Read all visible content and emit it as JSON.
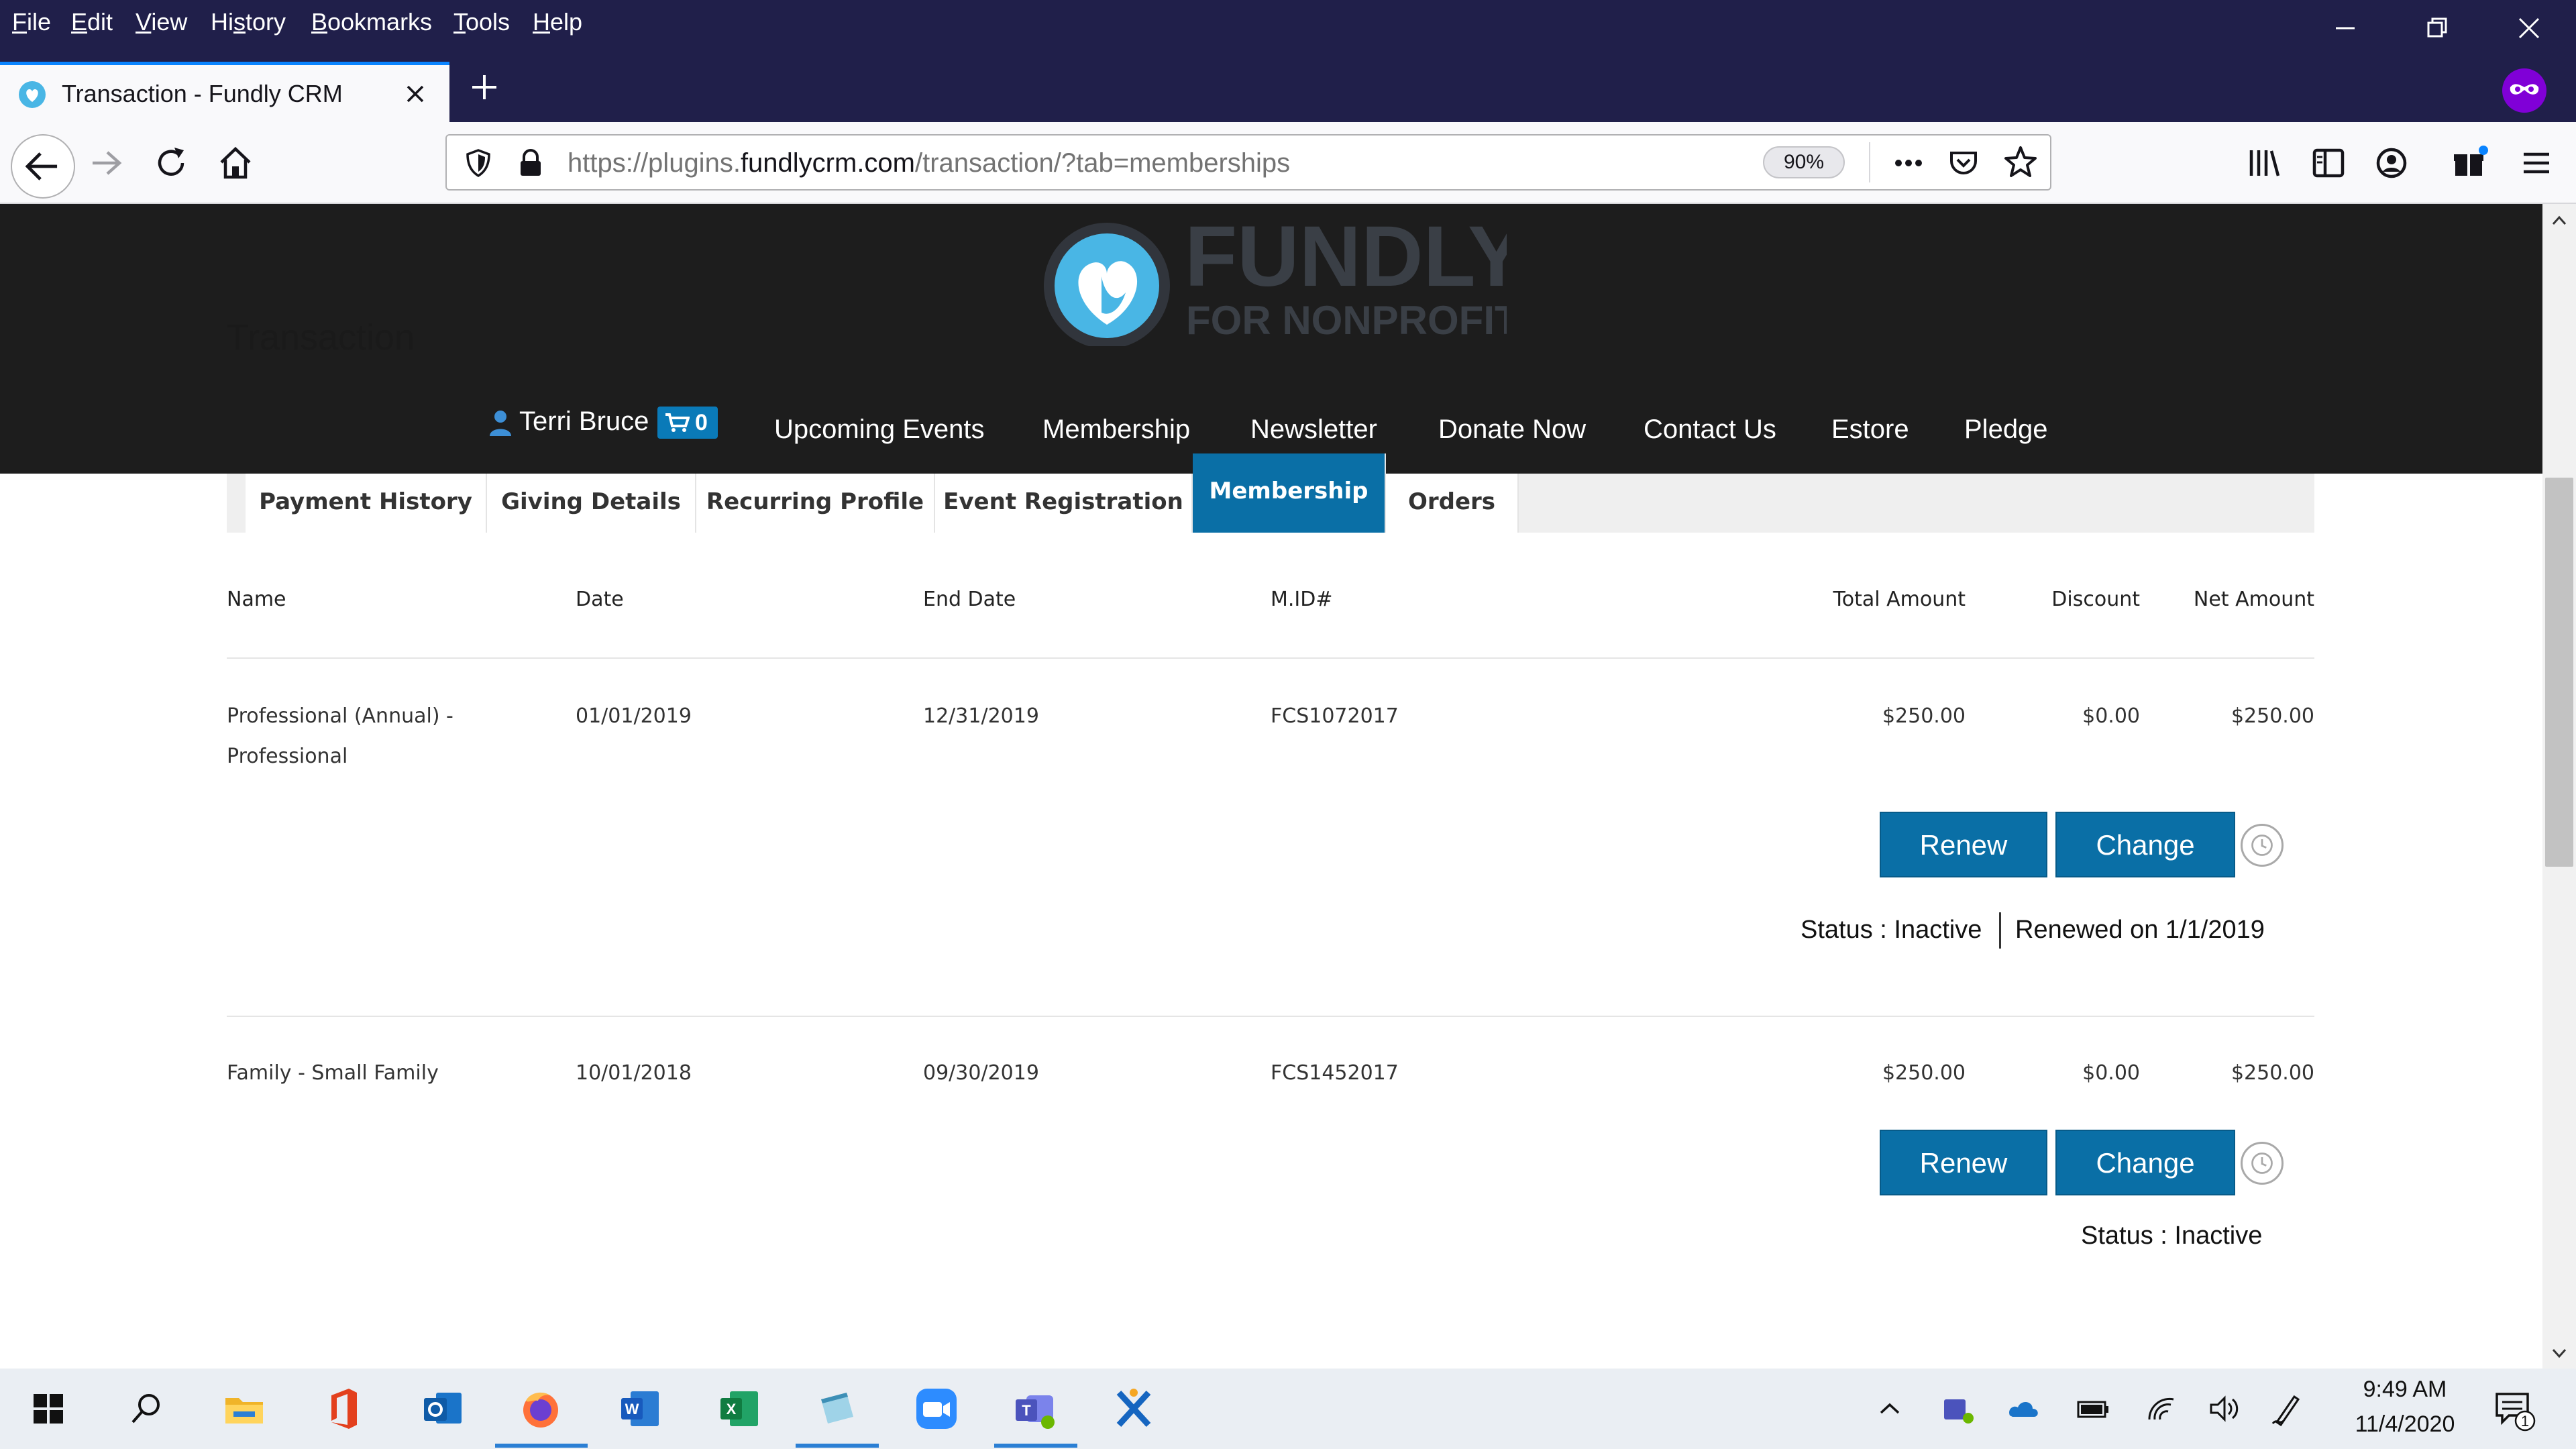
{
  "menubar": {
    "items": [
      {
        "accel": "F",
        "rest": "ile"
      },
      {
        "accel": "E",
        "rest": "dit"
      },
      {
        "accel": "V",
        "rest": "iew"
      },
      {
        "accel": "",
        "rest": "Hi",
        "accel2": "s",
        "rest2": "tory"
      },
      {
        "accel": "B",
        "rest": "ookmarks"
      },
      {
        "accel": "T",
        "rest": "ools"
      },
      {
        "accel": "H",
        "rest": "elp"
      }
    ]
  },
  "tab": {
    "title": "Transaction - Fundly CRM"
  },
  "urlbar": {
    "prefix": "https://plugins.",
    "domain": "fundlycrm.com",
    "suffix": "/transaction/?tab=memberships",
    "zoom": "90%"
  },
  "site": {
    "logo_word": "FUNDLY",
    "logo_tagline": "FOR NONPROFITS",
    "page_title": "Transaction",
    "user_name": "Terri Bruce",
    "cart_count": "0",
    "nav": [
      "Upcoming Events",
      "Membership",
      "Newsletter",
      "Donate Now",
      "Contact Us",
      "Estore",
      "Pledge"
    ]
  },
  "tabs": [
    "Payment History",
    "Giving Details",
    "Recurring Profile",
    "Event Registration",
    "Membership",
    "Orders"
  ],
  "active_tab": "Membership",
  "table": {
    "headers": {
      "name": "Name",
      "date": "Date",
      "end_date": "End Date",
      "mid": "M.ID#",
      "total": "Total Amount",
      "discount": "Discount",
      "net": "Net Amount"
    },
    "rows": [
      {
        "name_line1": "Professional (Annual) -",
        "name_line2": "Professional",
        "date": "01/01/2019",
        "end_date": "12/31/2019",
        "mid": "FCS1072017",
        "total": "$250.00",
        "discount": "$0.00",
        "net": "$250.00",
        "status": "Status : Inactive",
        "renewed": "Renewed on 1/1/2019"
      },
      {
        "name_line1": "Family - Small Family",
        "name_line2": "",
        "date": "10/01/2018",
        "end_date": "09/30/2019",
        "mid": "FCS1452017",
        "total": "$250.00",
        "discount": "$0.00",
        "net": "$250.00",
        "status": "Status : Inactive",
        "renewed": ""
      }
    ],
    "renew_label": "Renew",
    "change_label": "Change"
  },
  "taskbar": {
    "time": "9:49 AM",
    "date": "11/4/2020",
    "notification_count": "1"
  },
  "colors": {
    "firefox_frame": "#201f4a",
    "site_header": "#1d1d1d",
    "brand_blue": "#0a6fa6",
    "logo_heart": "#49b6e5"
  }
}
